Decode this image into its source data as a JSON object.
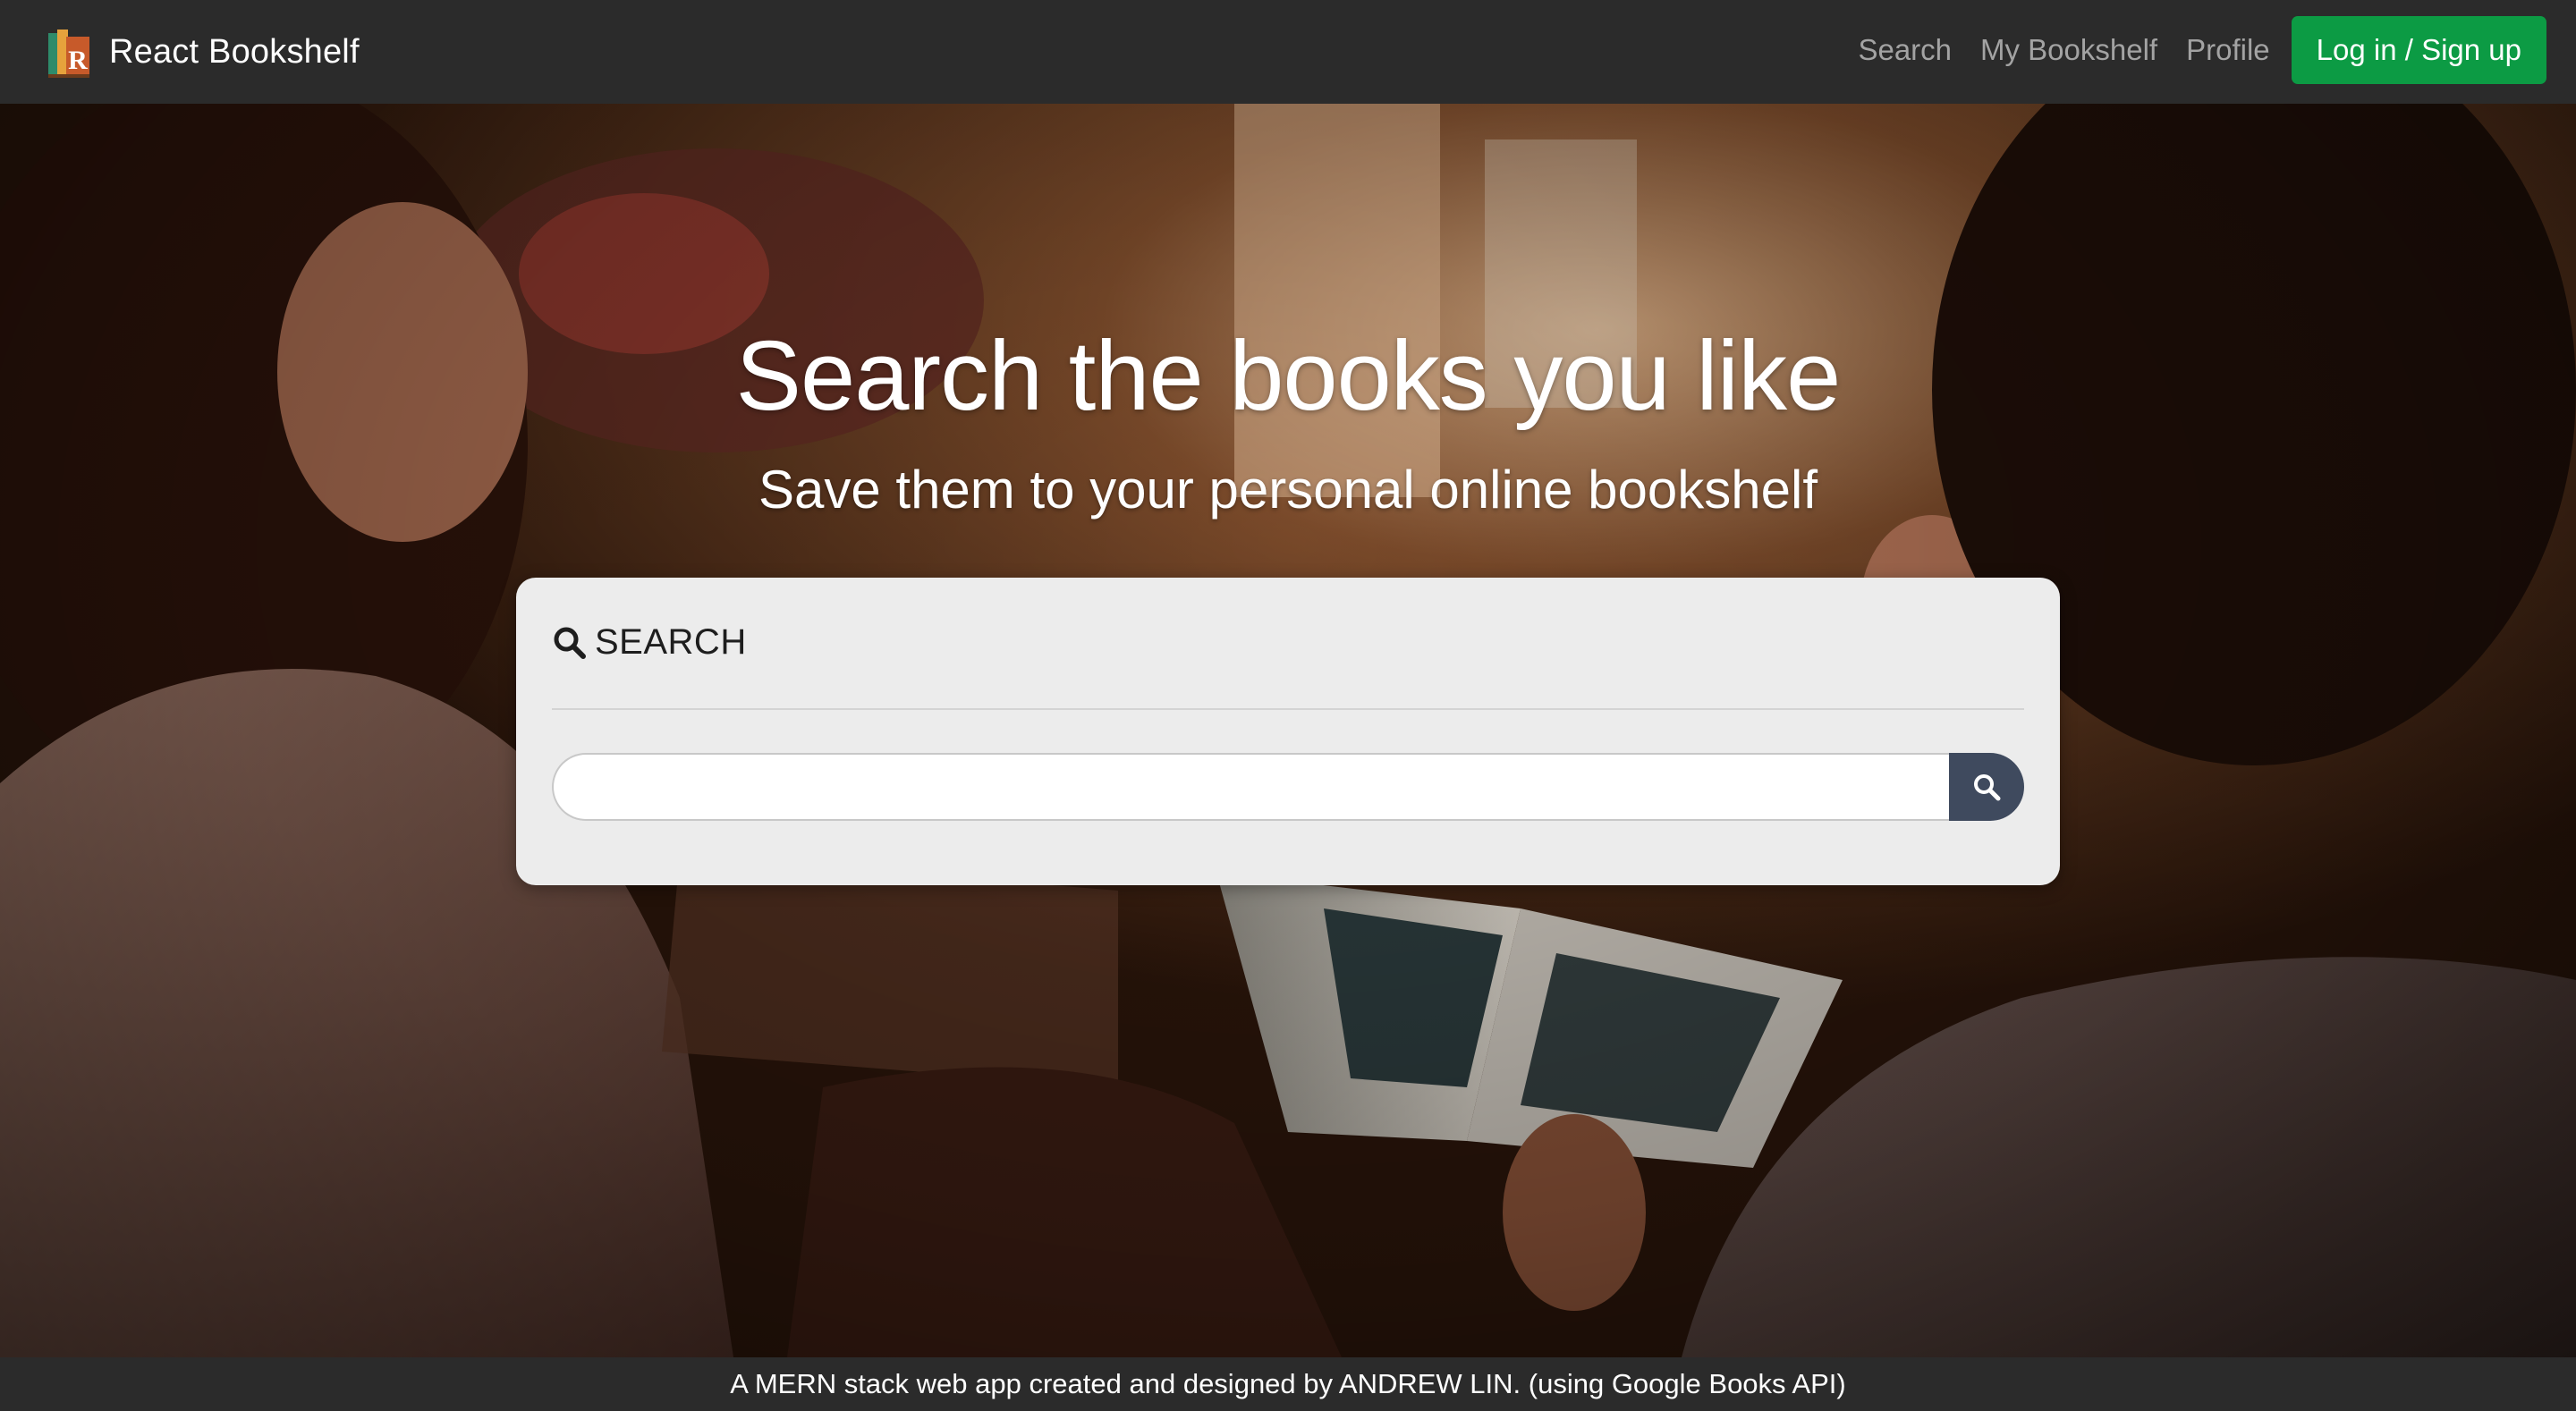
{
  "navbar": {
    "brand": "React Bookshelf",
    "logo_icon": "bookshelf-logo-icon",
    "links": [
      "Search",
      "My Bookshelf",
      "Profile"
    ],
    "login_label": "Log in / Sign up",
    "login_color": "#0c9b44"
  },
  "hero": {
    "title": "Search the books you like",
    "subtitle": "Save them to your personal online bookshelf"
  },
  "search_card": {
    "header_icon": "search-icon",
    "header_label": "SEARCH",
    "input_value": "",
    "input_placeholder": "",
    "button_icon": "search-icon",
    "button_color": "#3f4a5e"
  },
  "footer": {
    "text": "A MERN stack web app created and designed by ANDREW LIN. (using Google Books API)"
  }
}
